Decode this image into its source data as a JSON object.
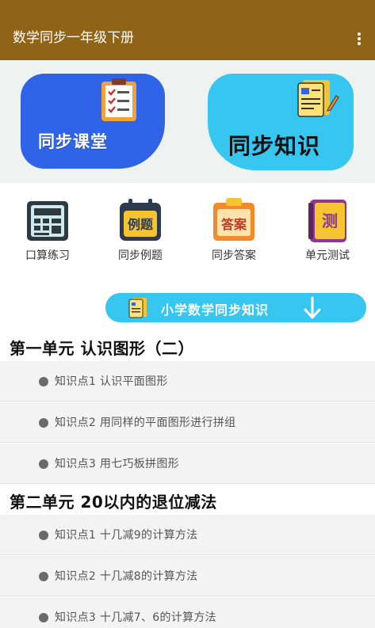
{
  "app": {
    "title": "数学同步一年级下册",
    "overflow_icon": "more-vert-icon"
  },
  "banner": {
    "left_card": {
      "label": "同步课堂",
      "icon": "clipboard-checklist-icon",
      "color": "#2f64e8"
    },
    "right_card": {
      "label": "同步知识",
      "icon": "notebook-pencil-icon",
      "color": "#36c6f0"
    }
  },
  "quick_menu": [
    {
      "label": "口算练习",
      "icon": "calculator-icon"
    },
    {
      "label": "同步例题",
      "icon": "calendar-examples-icon",
      "badge": "例题"
    },
    {
      "label": "同步答案",
      "icon": "clipboard-answers-icon",
      "badge": "答案"
    },
    {
      "label": "单元测试",
      "icon": "book-test-icon",
      "badge": "测"
    }
  ],
  "section_header": {
    "label": "小学数学同步知识",
    "icon": "notebook-icon",
    "arrow_icon": "arrow-down-icon"
  },
  "units": [
    {
      "title": "第一单元 认识图形（二）",
      "items": [
        "知识点1 认识平面图形",
        "知识点2 用同样的平面图形进行拼组",
        "知识点3 用七巧板拼图形"
      ]
    },
    {
      "title": "第二单元 20以内的退位减法",
      "items": [
        "知识点1 十几减9的计算方法",
        "知识点2 十几减8的计算方法",
        "知识点3 十几减7、6的计算方法"
      ]
    }
  ],
  "colors": {
    "appbar": "#8f6416",
    "accent_cyan": "#36c6f0",
    "accent_blue": "#2f64e8"
  }
}
